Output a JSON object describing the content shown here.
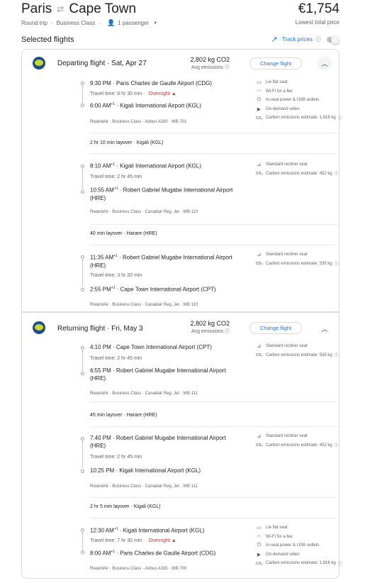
{
  "header": {
    "origin": "Paris",
    "destination": "Cape Town",
    "price": "€1,754",
    "price_caption": "Lowest total price",
    "trip_type": "Round trip",
    "cabin": "Business Class",
    "passengers": "1 passenger"
  },
  "selected": {
    "title": "Selected flights",
    "track_label": "Track prices"
  },
  "departing": {
    "title": "Departing flight · Sat, Apr 27",
    "co2": "2,802 kg CO2",
    "co2_caption": "Avg emissions",
    "change_label": "Change flight",
    "segments": [
      {
        "dep_time": "9:30 PM",
        "dep_sup": "",
        "dep_airport": "Paris Charles de Gaulle Airport (CDG)",
        "travel_time": "Travel time: 8 hr 30 min",
        "overnight": "Overnight",
        "arr_time": "6:00 AM",
        "arr_sup": "+1",
        "arr_airport": "Kigali International Airport (KGL)",
        "details": "RwandAir · Business Class · Airbus A330 · WB 701",
        "amenities": [
          "Lie flat seat",
          "Wi-Fi for a fee",
          "In-seat power & USB outlets",
          "On-demand video",
          "Carbon emissions estimate: 1,816 kg"
        ]
      },
      {
        "dep_time": "8:10 AM",
        "dep_sup": "+1",
        "dep_airport": "Kigali International Airport (KGL)",
        "travel_time": "Travel time: 2 hr 45 min",
        "overnight": "",
        "arr_time": "10:55 AM",
        "arr_sup": "+1",
        "arr_airport": "Robert Gabriel Mugabe International Airport (HRE)",
        "details": "RwandAir · Business Class · Canadair Reg. Jet · WB 110",
        "amenities": [
          "Standard recliner seat",
          "Carbon emissions estimate: 452 kg"
        ]
      },
      {
        "dep_time": "11:35 AM",
        "dep_sup": "+1",
        "dep_airport": "Robert Gabriel Mugabe International Airport (HRE)",
        "travel_time": "Travel time: 3 hr 20 min",
        "overnight": "",
        "arr_time": "2:55 PM",
        "arr_sup": "+1",
        "arr_airport": "Cape Town International Airport (CPT)",
        "details": "RwandAir · Business Class · Canadair Reg. Jet · WB 110",
        "amenities": [
          "Standard recliner seat",
          "Carbon emissions estimate: 535 kg"
        ]
      }
    ],
    "layovers": [
      "2 hr 10 min layover · Kigali (KGL)",
      "40 min layover · Harare (HRE)"
    ]
  },
  "returning": {
    "title": "Returning flight · Fri, May 3",
    "co2": "2,802 kg CO2",
    "co2_caption": "Avg emissions",
    "change_label": "Change flight",
    "segments": [
      {
        "dep_time": "4:10 PM",
        "dep_sup": "",
        "dep_airport": "Cape Town International Airport (CPT)",
        "travel_time": "Travel time: 2 hr 45 min",
        "overnight": "",
        "arr_time": "6:55 PM",
        "arr_sup": "",
        "arr_airport": "Robert Gabriel Mugabe International Airport (HRE)",
        "details": "RwandAir · Business Class · Canadair Reg. Jet · WB 111",
        "amenities": [
          "Standard recliner seat",
          "Carbon emissions estimate: 535 kg"
        ]
      },
      {
        "dep_time": "7:40 PM",
        "dep_sup": "",
        "dep_airport": "Robert Gabriel Mugabe International Airport (HRE)",
        "travel_time": "Travel time: 2 hr 45 min",
        "overnight": "",
        "arr_time": "10:25 PM",
        "arr_sup": "",
        "arr_airport": "Kigali International Airport (KGL)",
        "details": "RwandAir · Business Class · Canadair Reg. Jet · WB 111",
        "amenities": [
          "Standard recliner seat",
          "Carbon emissions estimate: 452 kg"
        ]
      },
      {
        "dep_time": "12:30 AM",
        "dep_sup": "+1",
        "dep_airport": "Kigali International Airport (KGL)",
        "travel_time": "Travel time: 7 hr 30 min",
        "overnight": "Overnight",
        "arr_time": "8:00 AM",
        "arr_sup": "+1",
        "arr_airport": "Paris Charles de Gaulle Airport (CDG)",
        "details": "RwandAir · Business Class · Airbus A330 · WB 700",
        "amenities": [
          "Lie flat seat",
          "Wi-Fi for a fee",
          "In-seat power & USB outlets",
          "On-demand video",
          "Carbon emissions estimate: 1,816 kg"
        ]
      }
    ],
    "layovers": [
      "45 min layover · Harare (HRE)",
      "2 hr 5 min layover · Kigali (KGL)"
    ]
  },
  "icons": {
    "lie_flat": "seat-icon",
    "wifi": "wifi-icon",
    "power": "power-outlet-icon",
    "video": "video-icon",
    "co2": "co2-icon",
    "recliner": "recliner-seat-icon"
  },
  "colors": {
    "accent": "#1a73e8",
    "warning": "#d93025",
    "muted": "#5f6368",
    "border": "#dadce0"
  }
}
